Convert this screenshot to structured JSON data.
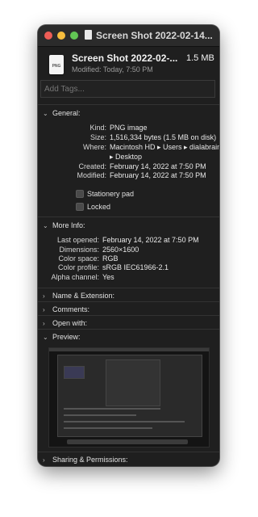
{
  "window": {
    "title": "Screen Shot 2022-02-14..."
  },
  "header": {
    "file_name": "Screen Shot 2022-02-...",
    "file_size": "1.5 MB",
    "modified": "Modified: Today, 7:50 PM",
    "icon_label": "PNG"
  },
  "tags": {
    "placeholder": "Add Tags..."
  },
  "general": {
    "heading": "General:",
    "kind_label": "Kind:",
    "kind_value": "PNG image",
    "size_label": "Size:",
    "size_value": "1,516,334 bytes (1.5 MB on disk)",
    "where_label": "Where:",
    "where_value_line1": "Macintosh HD ▸ Users ▸ dialabrain",
    "where_value_line2": "▸ Desktop",
    "created_label": "Created:",
    "created_value": "February 14, 2022 at 7:50 PM",
    "modified_label": "Modified:",
    "modified_value": "February 14, 2022 at 7:50 PM",
    "stationery_label": "Stationery pad",
    "locked_label": "Locked"
  },
  "more_info": {
    "heading": "More Info:",
    "last_opened_label": "Last opened:",
    "last_opened_value": "February 14, 2022 at 7:50 PM",
    "dimensions_label": "Dimensions:",
    "dimensions_value": "2560×1600",
    "color_space_label": "Color space:",
    "color_space_value": "RGB",
    "color_profile_label": "Color profile:",
    "color_profile_value": "sRGB IEC61966-2.1",
    "alpha_label": "Alpha channel:",
    "alpha_value": "Yes"
  },
  "sections": {
    "name_extension": "Name & Extension:",
    "comments": "Comments:",
    "open_with": "Open with:",
    "preview": "Preview:",
    "sharing": "Sharing & Permissions:"
  },
  "icons": {
    "expanded": "⌄",
    "collapsed": "›"
  },
  "colors": {
    "window_bg": "#1f1f1f",
    "close": "#ee5d56",
    "minimize": "#f6bd3d",
    "zoom": "#62c554"
  }
}
